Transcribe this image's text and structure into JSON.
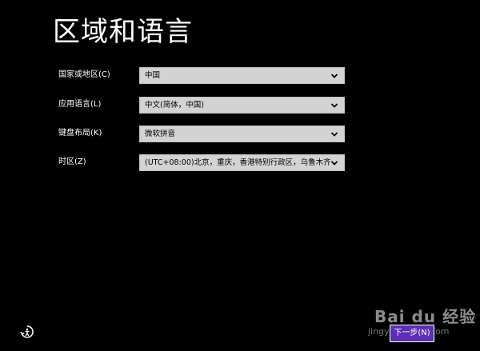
{
  "page": {
    "title": "区域和语言"
  },
  "fields": [
    {
      "label": "国家或地区(C)",
      "value": "中国",
      "icon": "chevron-down-icon"
    },
    {
      "label": "应用语言(L)",
      "value": "中文(简体，中国)",
      "icon": "chevron-down-icon"
    },
    {
      "label": "键盘布局(K)",
      "value": "微软拼音",
      "icon": "chevron-down-icon"
    },
    {
      "label": "时区(Z)",
      "value": "(UTC+08:00)北京，重庆，香港特别行政区，乌鲁木齐",
      "icon": "chevron-down-icon"
    }
  ],
  "footer": {
    "accessibility_icon": "ease-of-access-icon",
    "next_label": "下一步(N)"
  },
  "watermark": {
    "brand": "Bai du 经验",
    "url": "jingyan.baidu.com"
  },
  "colors": {
    "background": "#000000",
    "select_bg": "#d3d3d3",
    "accent": "#5d2fb5"
  }
}
